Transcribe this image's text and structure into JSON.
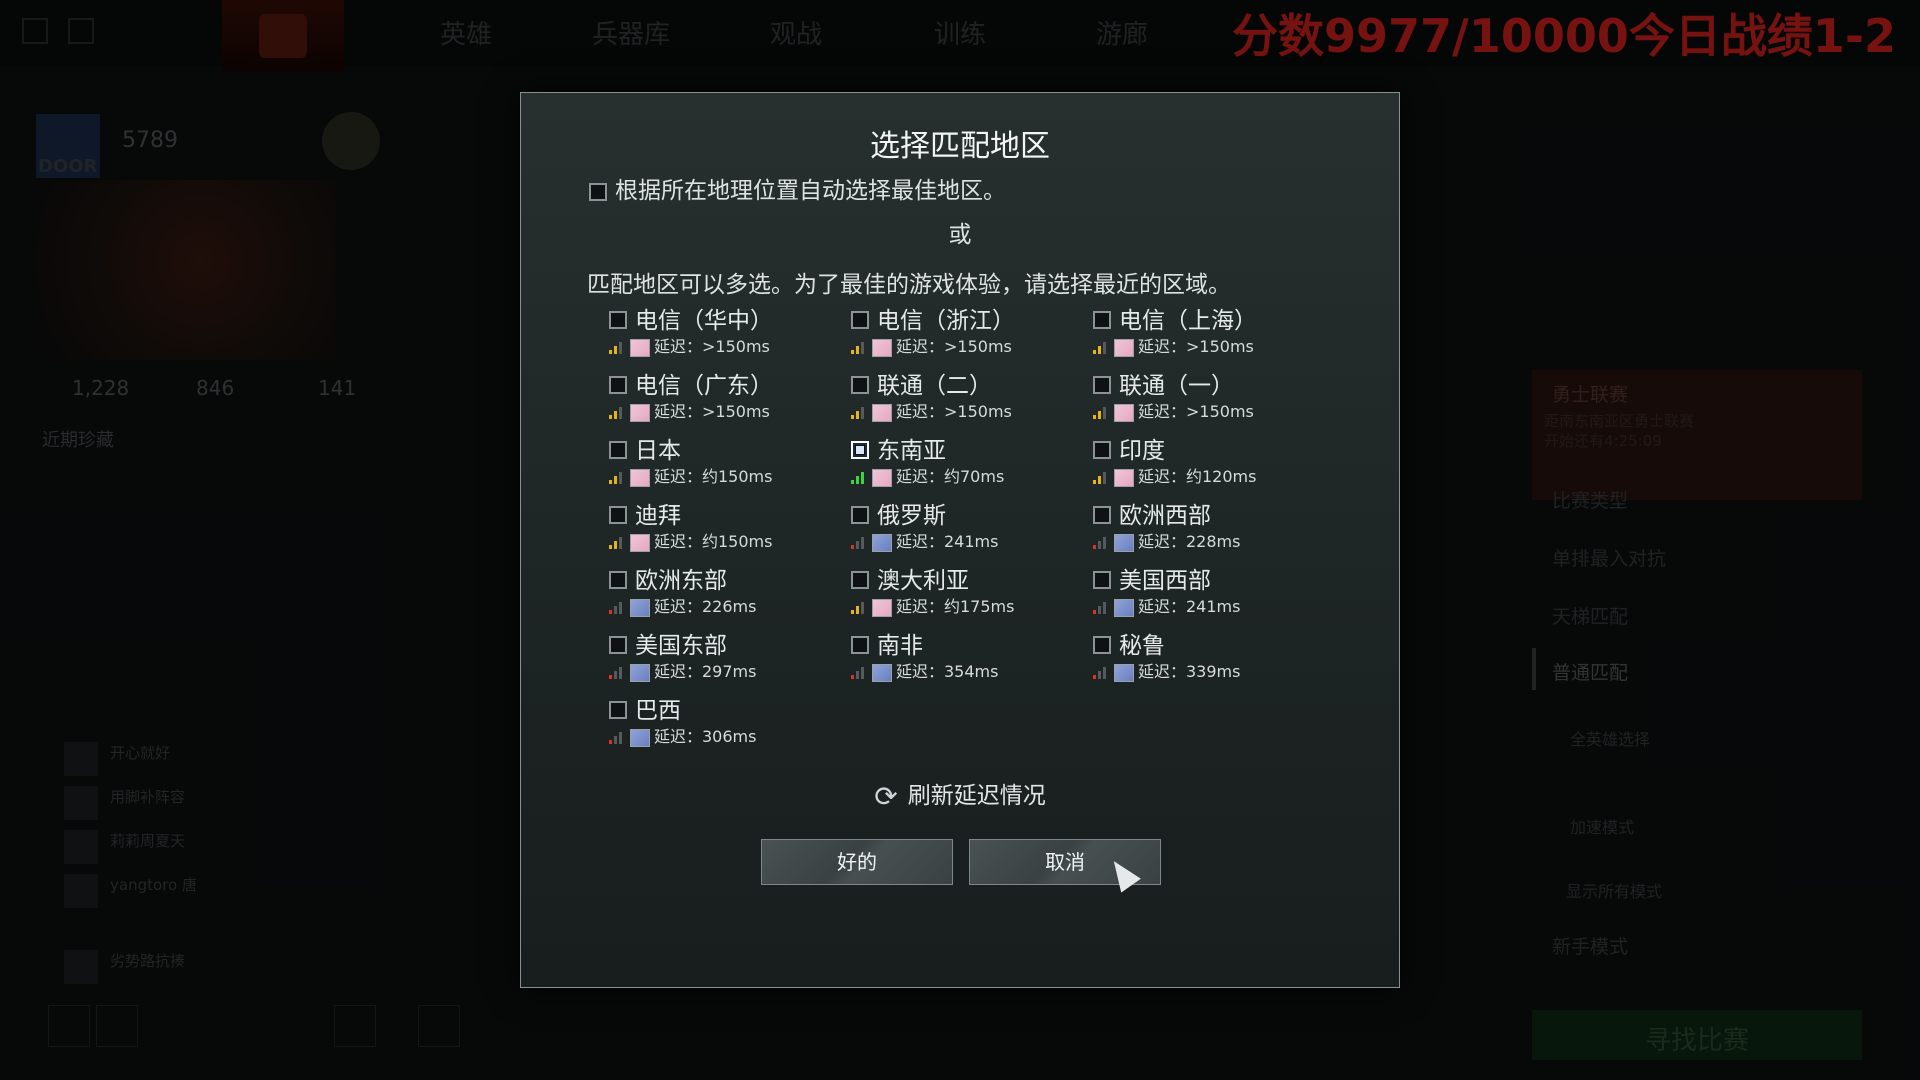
{
  "overlay": {
    "score_text": "分数9977/10000今日战绩1-2"
  },
  "background": {
    "nav": [
      "英雄",
      "兵器库",
      "观战",
      "训练",
      "游廊"
    ],
    "profile": {
      "avatar_label": "DOOR",
      "mmr": "5789",
      "stats": [
        "1,228",
        "846",
        "141"
      ]
    },
    "recent_title": "近期珍藏",
    "friends": [
      {
        "name": "开心就好"
      },
      {
        "name": "用脚补阵容"
      },
      {
        "name": "莉莉周夏天"
      },
      {
        "name": "yangtoro 唐"
      },
      {
        "name": "劣势路抗揍"
      }
    ],
    "right_panel": {
      "card_title": "勇士联赛",
      "card_sub1": "距南东南亚区勇士联赛",
      "card_sub2": "开始还有4:25:09",
      "items": [
        "比赛类型",
        "单排最入对抗",
        "天梯匹配",
        "普通匹配",
        "全英雄选择",
        "加速模式",
        "显示所有模式",
        "新手模式"
      ],
      "find_match": "寻找比赛"
    }
  },
  "dialog": {
    "title": "选择匹配地区",
    "auto_select_label": "根据所在地理位置自动选择最佳地区。",
    "or": "或",
    "description": "匹配地区可以多选。为了最佳的游戏体验，请选择最近的区域。",
    "regions": [
      {
        "name": "电信（华中）",
        "latency": "延迟：>150ms",
        "signal": "yellow",
        "checked": false
      },
      {
        "name": "电信（浙江）",
        "latency": "延迟：>150ms",
        "signal": "yellow",
        "checked": false
      },
      {
        "name": "电信（上海）",
        "latency": "延迟：>150ms",
        "signal": "yellow",
        "checked": false
      },
      {
        "name": "电信（广东）",
        "latency": "延迟：>150ms",
        "signal": "yellow",
        "checked": false
      },
      {
        "name": "联通（二）",
        "latency": "延迟：>150ms",
        "signal": "yellow",
        "checked": false
      },
      {
        "name": "联通（一）",
        "latency": "延迟：>150ms",
        "signal": "yellow",
        "checked": false
      },
      {
        "name": "日本",
        "latency": "延迟：约150ms",
        "signal": "yellow",
        "checked": false
      },
      {
        "name": "东南亚",
        "latency": "延迟：约70ms",
        "signal": "green",
        "checked": true
      },
      {
        "name": "印度",
        "latency": "延迟：约120ms",
        "signal": "yellow",
        "checked": false
      },
      {
        "name": "迪拜",
        "latency": "延迟：约150ms",
        "signal": "yellow",
        "checked": false
      },
      {
        "name": "俄罗斯",
        "latency": "延迟：241ms",
        "signal": "red",
        "checked": false
      },
      {
        "name": "欧洲西部",
        "latency": "延迟：228ms",
        "signal": "red",
        "checked": false
      },
      {
        "name": "欧洲东部",
        "latency": "延迟：226ms",
        "signal": "red",
        "checked": false
      },
      {
        "name": "澳大利亚",
        "latency": "延迟：约175ms",
        "signal": "yellow",
        "checked": false
      },
      {
        "name": "美国西部",
        "latency": "延迟：241ms",
        "signal": "red",
        "checked": false
      },
      {
        "name": "美国东部",
        "latency": "延迟：297ms",
        "signal": "red",
        "checked": false
      },
      {
        "name": "南非",
        "latency": "延迟：354ms",
        "signal": "red",
        "checked": false
      },
      {
        "name": "秘鲁",
        "latency": "延迟：339ms",
        "signal": "red",
        "checked": false
      },
      {
        "name": "巴西",
        "latency": "延迟：306ms",
        "signal": "red",
        "checked": false
      }
    ],
    "refresh_label": "刷新延迟情况",
    "ok_label": "好的",
    "cancel_label": "取消"
  },
  "colors": {
    "signal_yellow": "#e8b21a",
    "signal_green": "#3fd43f",
    "signal_red": "#d6332a",
    "signal_dim": "#555a5c"
  }
}
